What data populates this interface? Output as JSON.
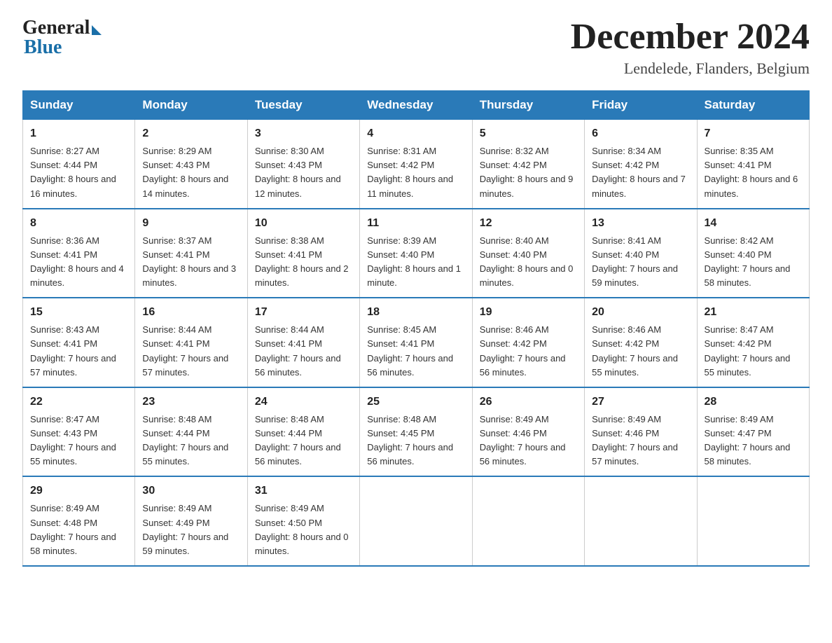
{
  "header": {
    "logo_general": "General",
    "logo_blue": "Blue",
    "month_title": "December 2024",
    "location": "Lendelede, Flanders, Belgium"
  },
  "days_of_week": [
    "Sunday",
    "Monday",
    "Tuesday",
    "Wednesday",
    "Thursday",
    "Friday",
    "Saturday"
  ],
  "weeks": [
    [
      {
        "day": "1",
        "sunrise": "8:27 AM",
        "sunset": "4:44 PM",
        "daylight": "8 hours and 16 minutes."
      },
      {
        "day": "2",
        "sunrise": "8:29 AM",
        "sunset": "4:43 PM",
        "daylight": "8 hours and 14 minutes."
      },
      {
        "day": "3",
        "sunrise": "8:30 AM",
        "sunset": "4:43 PM",
        "daylight": "8 hours and 12 minutes."
      },
      {
        "day": "4",
        "sunrise": "8:31 AM",
        "sunset": "4:42 PM",
        "daylight": "8 hours and 11 minutes."
      },
      {
        "day": "5",
        "sunrise": "8:32 AM",
        "sunset": "4:42 PM",
        "daylight": "8 hours and 9 minutes."
      },
      {
        "day": "6",
        "sunrise": "8:34 AM",
        "sunset": "4:42 PM",
        "daylight": "8 hours and 7 minutes."
      },
      {
        "day": "7",
        "sunrise": "8:35 AM",
        "sunset": "4:41 PM",
        "daylight": "8 hours and 6 minutes."
      }
    ],
    [
      {
        "day": "8",
        "sunrise": "8:36 AM",
        "sunset": "4:41 PM",
        "daylight": "8 hours and 4 minutes."
      },
      {
        "day": "9",
        "sunrise": "8:37 AM",
        "sunset": "4:41 PM",
        "daylight": "8 hours and 3 minutes."
      },
      {
        "day": "10",
        "sunrise": "8:38 AM",
        "sunset": "4:41 PM",
        "daylight": "8 hours and 2 minutes."
      },
      {
        "day": "11",
        "sunrise": "8:39 AM",
        "sunset": "4:40 PM",
        "daylight": "8 hours and 1 minute."
      },
      {
        "day": "12",
        "sunrise": "8:40 AM",
        "sunset": "4:40 PM",
        "daylight": "8 hours and 0 minutes."
      },
      {
        "day": "13",
        "sunrise": "8:41 AM",
        "sunset": "4:40 PM",
        "daylight": "7 hours and 59 minutes."
      },
      {
        "day": "14",
        "sunrise": "8:42 AM",
        "sunset": "4:40 PM",
        "daylight": "7 hours and 58 minutes."
      }
    ],
    [
      {
        "day": "15",
        "sunrise": "8:43 AM",
        "sunset": "4:41 PM",
        "daylight": "7 hours and 57 minutes."
      },
      {
        "day": "16",
        "sunrise": "8:44 AM",
        "sunset": "4:41 PM",
        "daylight": "7 hours and 57 minutes."
      },
      {
        "day": "17",
        "sunrise": "8:44 AM",
        "sunset": "4:41 PM",
        "daylight": "7 hours and 56 minutes."
      },
      {
        "day": "18",
        "sunrise": "8:45 AM",
        "sunset": "4:41 PM",
        "daylight": "7 hours and 56 minutes."
      },
      {
        "day": "19",
        "sunrise": "8:46 AM",
        "sunset": "4:42 PM",
        "daylight": "7 hours and 56 minutes."
      },
      {
        "day": "20",
        "sunrise": "8:46 AM",
        "sunset": "4:42 PM",
        "daylight": "7 hours and 55 minutes."
      },
      {
        "day": "21",
        "sunrise": "8:47 AM",
        "sunset": "4:42 PM",
        "daylight": "7 hours and 55 minutes."
      }
    ],
    [
      {
        "day": "22",
        "sunrise": "8:47 AM",
        "sunset": "4:43 PM",
        "daylight": "7 hours and 55 minutes."
      },
      {
        "day": "23",
        "sunrise": "8:48 AM",
        "sunset": "4:44 PM",
        "daylight": "7 hours and 55 minutes."
      },
      {
        "day": "24",
        "sunrise": "8:48 AM",
        "sunset": "4:44 PM",
        "daylight": "7 hours and 56 minutes."
      },
      {
        "day": "25",
        "sunrise": "8:48 AM",
        "sunset": "4:45 PM",
        "daylight": "7 hours and 56 minutes."
      },
      {
        "day": "26",
        "sunrise": "8:49 AM",
        "sunset": "4:46 PM",
        "daylight": "7 hours and 56 minutes."
      },
      {
        "day": "27",
        "sunrise": "8:49 AM",
        "sunset": "4:46 PM",
        "daylight": "7 hours and 57 minutes."
      },
      {
        "day": "28",
        "sunrise": "8:49 AM",
        "sunset": "4:47 PM",
        "daylight": "7 hours and 58 minutes."
      }
    ],
    [
      {
        "day": "29",
        "sunrise": "8:49 AM",
        "sunset": "4:48 PM",
        "daylight": "7 hours and 58 minutes."
      },
      {
        "day": "30",
        "sunrise": "8:49 AM",
        "sunset": "4:49 PM",
        "daylight": "7 hours and 59 minutes."
      },
      {
        "day": "31",
        "sunrise": "8:49 AM",
        "sunset": "4:50 PM",
        "daylight": "8 hours and 0 minutes."
      },
      null,
      null,
      null,
      null
    ]
  ],
  "labels": {
    "sunrise_prefix": "Sunrise: ",
    "sunset_prefix": "Sunset: ",
    "daylight_prefix": "Daylight: "
  }
}
